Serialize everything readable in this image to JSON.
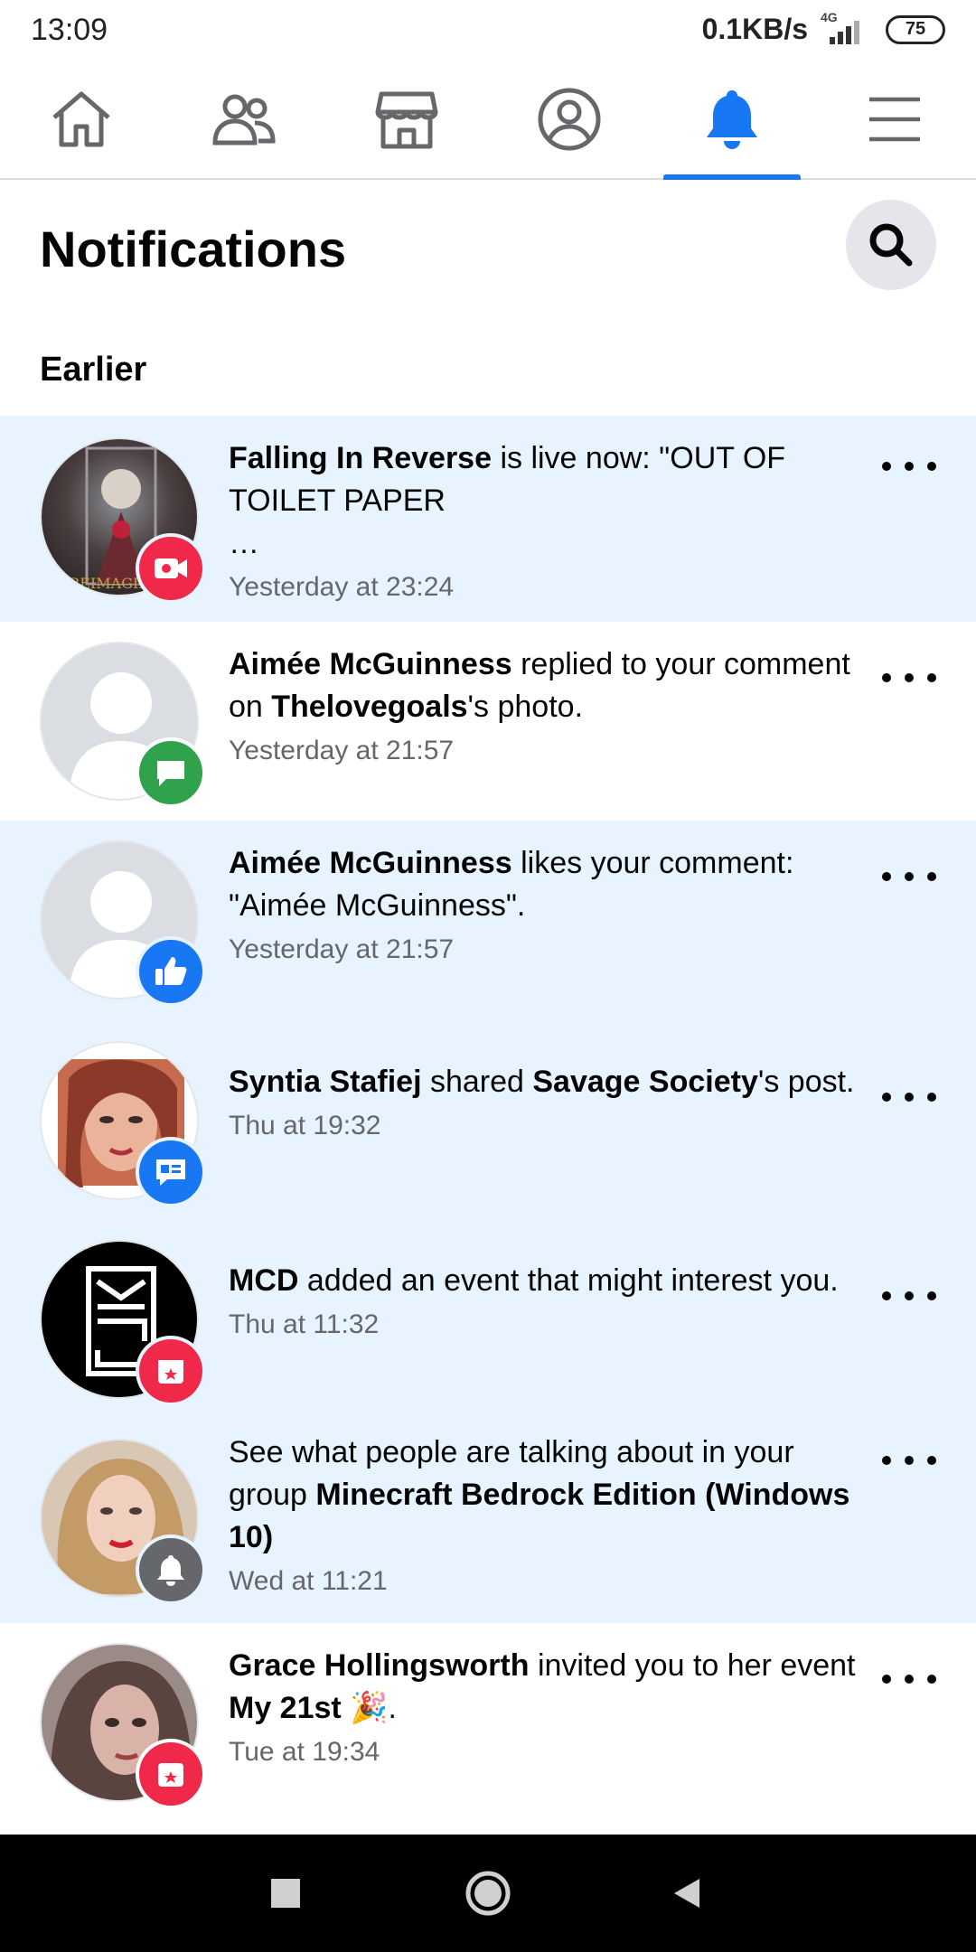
{
  "status_bar": {
    "time": "13:09",
    "net_speed": "0.1KB/s",
    "network": "4G",
    "battery": "75"
  },
  "top_nav": {
    "items": [
      {
        "icon": "home-icon"
      },
      {
        "icon": "friends-icon"
      },
      {
        "icon": "marketplace-icon"
      },
      {
        "icon": "profile-icon"
      },
      {
        "icon": "bell-icon",
        "active": true
      },
      {
        "icon": "menu-icon"
      }
    ],
    "active_color": "#1877f2"
  },
  "header": {
    "title": "Notifications",
    "search_icon": "search-icon"
  },
  "section": {
    "title": "Earlier"
  },
  "notifications": [
    {
      "unread": true,
      "actor": "Falling In Reverse",
      "text": " is live now: \"OUT OF TOILET PAPER",
      "ellipsis": "…",
      "time": "Yesterday at 23:24",
      "badge": "live-video-icon",
      "badge_color": "#f02849"
    },
    {
      "unread": false,
      "actor": "Aimée McGuinness",
      "text1": " replied to your comment on ",
      "target": "Thelovegoals",
      "text2": "'s photo.",
      "time": "Yesterday at 21:57",
      "badge": "comment-icon",
      "badge_color": "#31a24c"
    },
    {
      "unread": true,
      "actor": "Aimée McGuinness",
      "text": " likes your comment: \"Aimée McGuinness\".",
      "time": "Yesterday at 21:57",
      "badge": "like-icon",
      "badge_color": "#1877f2"
    },
    {
      "unread": true,
      "actor": "Syntia Stafiej",
      "text1": " shared ",
      "target": "Savage Society",
      "text2": "'s post.",
      "time": "Thu at 19:32",
      "badge": "share-icon",
      "badge_color": "#1877f2"
    },
    {
      "unread": true,
      "actor": "MCD",
      "text": " added an event that might interest you.",
      "time": "Thu at 11:32",
      "badge": "event-icon",
      "badge_color": "#f02849"
    },
    {
      "unread": true,
      "text1": "See what people are talking about in your group ",
      "target": "Minecraft Bedrock Edition (Windows 10)",
      "time": "Wed at 11:21",
      "badge": "bell-icon",
      "badge_color": "#65676b"
    },
    {
      "unread": false,
      "actor": "Grace Hollingsworth",
      "text1": " invited you to her event ",
      "target": "My 21st",
      "text2": " 🎉.",
      "time": "Tue at 19:34",
      "badge": "event-icon",
      "badge_color": "#f02849"
    }
  ],
  "system_nav": {
    "recents": "recents-icon",
    "home": "home-circle-icon",
    "back": "back-icon"
  }
}
